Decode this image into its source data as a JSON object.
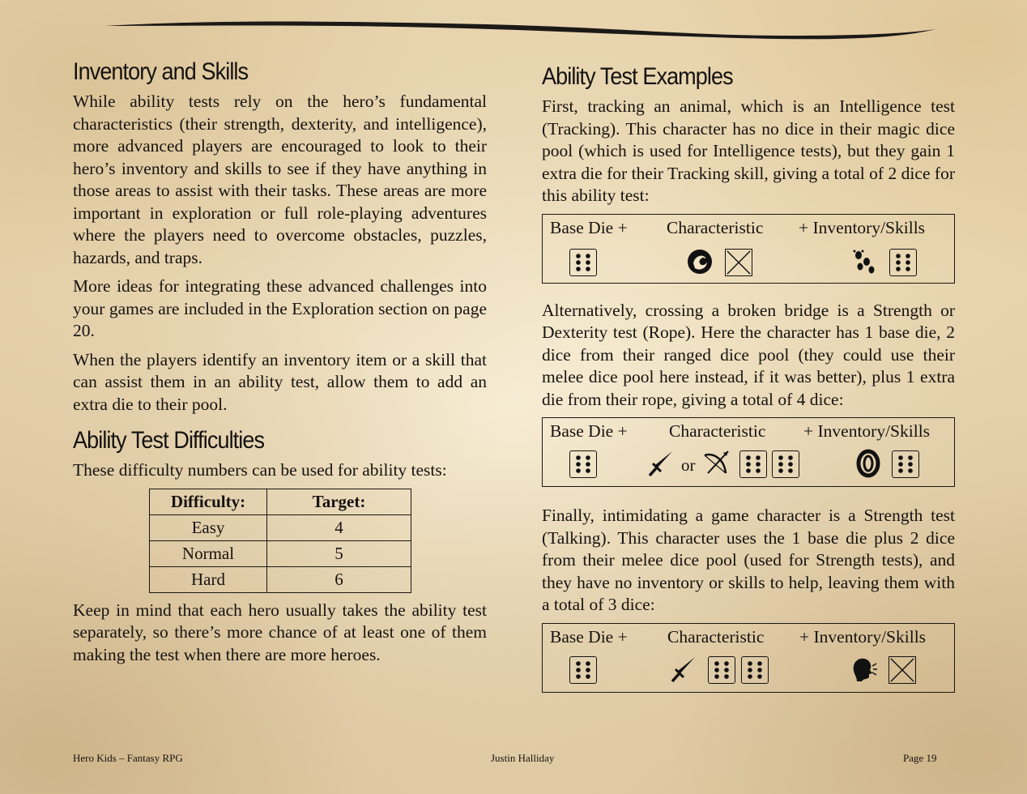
{
  "left": {
    "heading1": "Inventory and Skills",
    "p1": "While ability tests rely on the hero’s fundamental characteristics (their strength, dexterity, and intelligence), more advanced players are encouraged to look to their hero’s inventory and skills to see if they have anything in those areas to assist with their tasks.  These areas are more important in exploration or full role-playing adventures where the players need to overcome obstacles, puzzles, hazards, and traps.",
    "p2": "More ideas for integrating these advanced challenges into your games are included in the Exploration section on page 20.",
    "p3": "When the players identify an inventory item or a skill that can assist them in an ability test, allow them to add an extra die to their pool.",
    "heading2": "Ability Test Difficulties",
    "p4": "These difficulty numbers can be used for ability tests:",
    "table": {
      "headers": [
        "Difficulty:",
        "Target:"
      ],
      "rows": [
        [
          "Easy",
          "4"
        ],
        [
          "Normal",
          "5"
        ],
        [
          "Hard",
          "6"
        ]
      ]
    },
    "p5": "Keep in mind that each hero usually takes the ability test separately, so there’s more chance of at least one of them making the test when there are more heroes."
  },
  "right": {
    "heading": "Ability Test Examples",
    "p1": "First, tracking an animal, which is an Intelligence test (Tracking).  This character has no dice in their magic dice pool (which is used for Intelligence tests), but they gain 1 extra die for their Tracking skill, giving a total of 2 dice for this ability test:",
    "p2": "Alternatively, crossing a broken bridge is a Strength or Dexterity test (Rope).  Here the character has 1 base die, 2 dice from their ranged dice pool (they could use their melee dice pool here instead, if it was better), plus 1 extra die from their rope, giving a total of 4 dice:",
    "p3": "Finally, intimidating a game character is a Strength test (Talking).  This character uses the 1 base die plus 2 dice from their melee dice pool (used for Strength tests), and they have no inventory or skills to help, leaving them with a total of 3 dice:",
    "box_labels": {
      "base": "Base Die  +",
      "characteristic": "Characteristic",
      "inventory": "+  Inventory/Skills",
      "or": "or"
    },
    "box_icons": {
      "example1": [
        "d6-six",
        "magic-icon",
        "empty-die",
        "tracks-icon",
        "d6-six"
      ],
      "example2": [
        "d6-six",
        "melee-sword-icon",
        "ranged-bow-icon",
        "d6-six",
        "d6-six",
        "rope-icon",
        "d6-six"
      ],
      "example3": [
        "d6-six",
        "melee-sword-icon",
        "d6-six",
        "d6-six",
        "talking-head-icon",
        "empty-die"
      ]
    }
  },
  "footer": {
    "left": "Hero Kids – Fantasy RPG",
    "center": "Justin Halliday",
    "right": "Page 19"
  }
}
